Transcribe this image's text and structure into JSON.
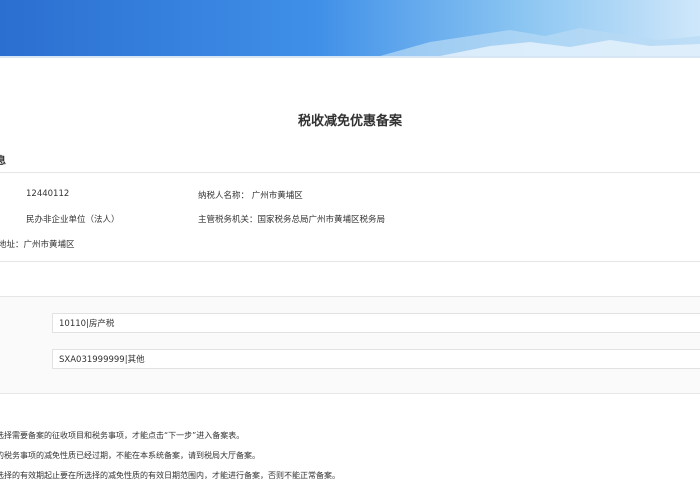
{
  "header": {
    "banner_image": "sky-mountain-banner"
  },
  "page": {
    "title": "税收减免优惠备案"
  },
  "taxpayer_info": {
    "section_label": "息",
    "taxpayer_id": "12440112",
    "taxpayer_name": "纳税人名称：  广州市黄埔区",
    "taxpayer_type": "民办非企业单位（法人）",
    "tax_authority": "主管税务机关：国家税务总局广州市黄埔区税务局",
    "address": "地址：广州市黄埔区"
  },
  "form": {
    "levy_item": "10110|房产税",
    "tax_matter": "SXA031999999|其他"
  },
  "notes": [
    "选择需要备案的征收项目和税务事项，才能点击“下一步”进入备案表。",
    "的税务事项的减免性质已经过期，不能在本系统备案，请到税局大厅备案。",
    "选择的有效期起止要在所选择的减免性质的有效日期范围内，才能进行备案，否则不能正常备案。"
  ],
  "colors": {
    "banner_start": "#2b6fd0",
    "banner_end": "#cfe7fa",
    "panel_bg": "#fafafa"
  }
}
